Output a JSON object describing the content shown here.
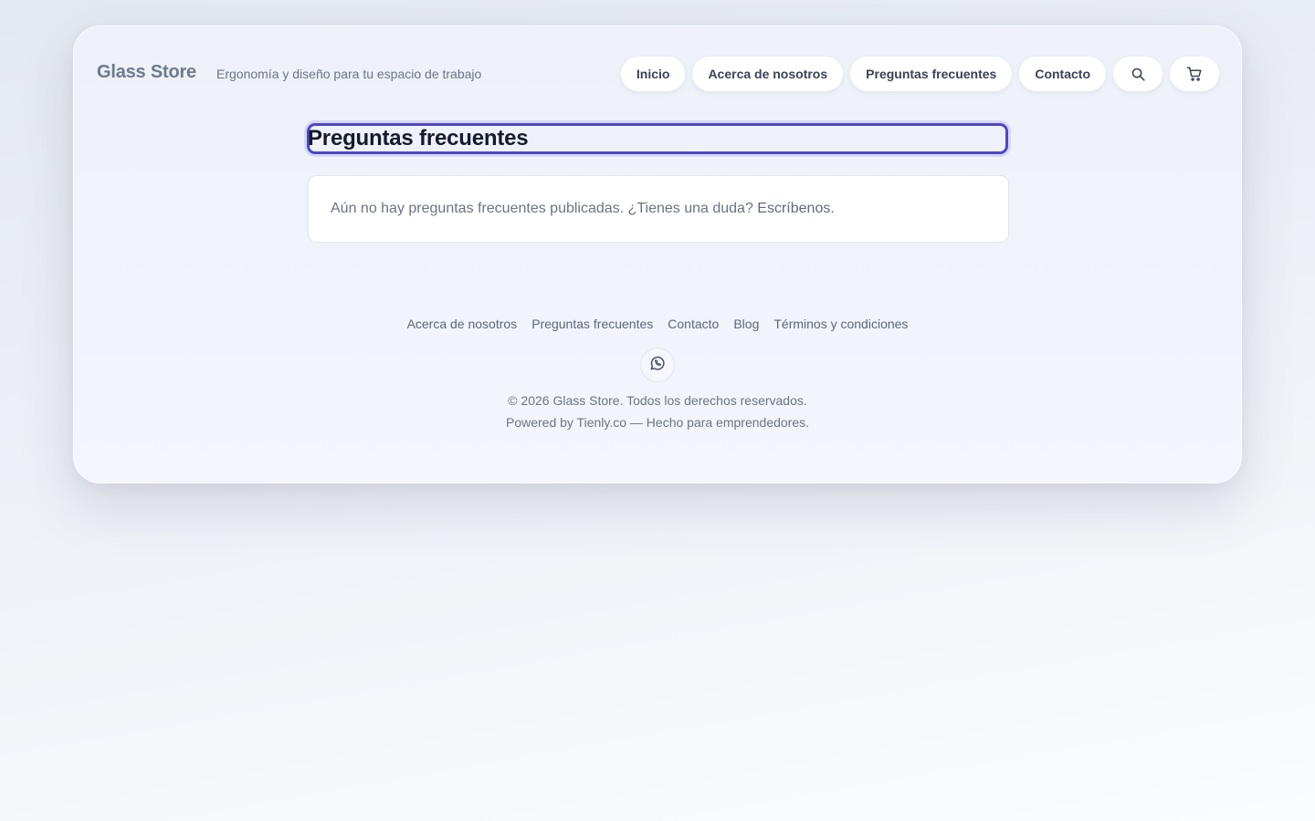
{
  "header": {
    "brand": "Glass Store",
    "tagline": "Ergonomía y diseño para tu espacio de trabajo",
    "nav": [
      {
        "label": "Inicio"
      },
      {
        "label": "Acerca de nosotros"
      },
      {
        "label": "Preguntas frecuentes"
      },
      {
        "label": "Contacto"
      }
    ],
    "icons": {
      "search": "search-icon",
      "cart": "cart-icon"
    }
  },
  "main": {
    "title": "Preguntas frecuentes",
    "empty_text": "Aún no hay preguntas frecuentes publicadas. ¿Tienes una duda?",
    "empty_link": "Escríbenos",
    "empty_suffix": "."
  },
  "footer": {
    "links": [
      {
        "label": "Acerca de nosotros"
      },
      {
        "label": "Preguntas frecuentes"
      },
      {
        "label": "Contacto"
      },
      {
        "label": "Blog"
      },
      {
        "label": "Términos y condiciones"
      }
    ],
    "social_icon": "whatsapp-icon",
    "copyright": "© 2026 Glass Store. Todos los derechos reservados.",
    "powered": "Powered by Tienly.co — Hecho para emprendedores."
  },
  "colors": {
    "accent": "#4f46c8",
    "brand_text": "#6b7a90",
    "title_text": "#161b2b"
  }
}
